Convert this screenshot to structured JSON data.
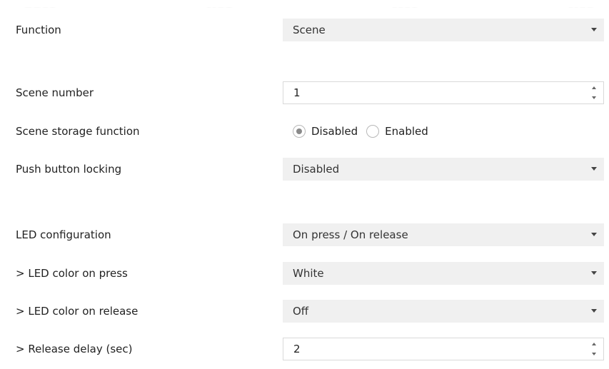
{
  "rows": {
    "function": {
      "label": "Function",
      "value": "Scene",
      "icon": "chevron-down-icon"
    },
    "scene_number": {
      "label": "Scene number",
      "value": "1",
      "icon": "spinner-arrows-icon"
    },
    "scene_storage": {
      "label": "Scene storage function",
      "options": [
        {
          "label": "Disabled",
          "checked": true
        },
        {
          "label": "Enabled",
          "checked": false
        }
      ]
    },
    "push_button_locking": {
      "label": "Push button locking",
      "value": "Disabled",
      "icon": "chevron-down-icon"
    },
    "led_configuration": {
      "label": "LED configuration",
      "value": "On press / On release",
      "icon": "chevron-down-icon"
    },
    "led_color_press": {
      "label": "> LED color on press",
      "value": "White",
      "icon": "chevron-down-icon"
    },
    "led_color_release": {
      "label": "> LED color on release",
      "value": "Off",
      "icon": "chevron-down-icon"
    },
    "release_delay": {
      "label": "> Release delay (sec)",
      "value": "2",
      "icon": "spinner-arrows-icon"
    }
  },
  "colors": {
    "select_bg": "#f0f0f0",
    "spin_border": "#d9d9d9",
    "radio_dot": "#8a8a8a",
    "text": "#222222"
  }
}
